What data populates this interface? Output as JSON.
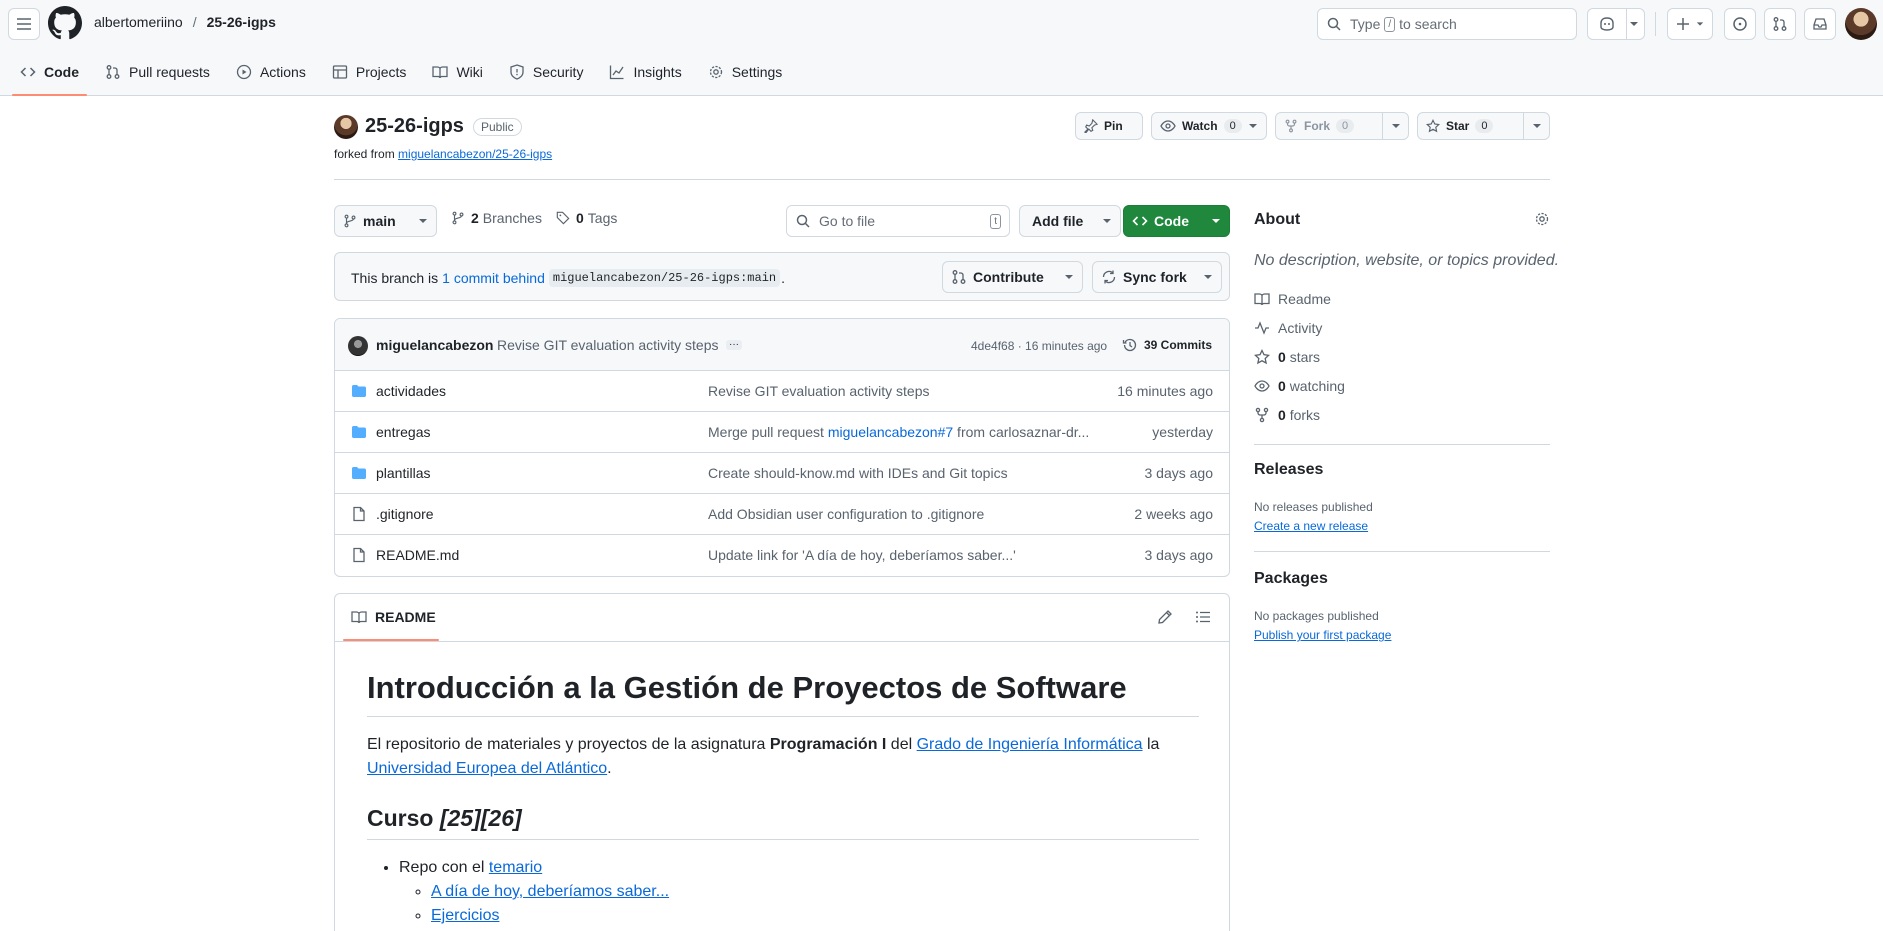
{
  "header": {
    "owner": "albertomeriino",
    "separator": "/",
    "repo": "25-26-igps",
    "search_prefix": "Type",
    "search_key": "/",
    "search_suffix": "to search"
  },
  "tabs": [
    {
      "label": "Code",
      "icon": "code-icon"
    },
    {
      "label": "Pull requests",
      "icon": "pull-request-icon"
    },
    {
      "label": "Actions",
      "icon": "play-icon"
    },
    {
      "label": "Projects",
      "icon": "table-icon"
    },
    {
      "label": "Wiki",
      "icon": "book-icon"
    },
    {
      "label": "Security",
      "icon": "shield-icon"
    },
    {
      "label": "Insights",
      "icon": "graph-icon"
    },
    {
      "label": "Settings",
      "icon": "gear-icon"
    }
  ],
  "repo": {
    "name": "25-26-igps",
    "visibility": "Public",
    "forked_prefix": "forked from",
    "forked_from": "miguelancabezon/25-26-igps",
    "pin": "Pin",
    "watch": "Watch",
    "watch_count": "0",
    "fork": "Fork",
    "fork_count": "0",
    "star": "Star",
    "star_count": "0"
  },
  "branchbar": {
    "branch": "main",
    "branches_count": "2",
    "branches_label": "Branches",
    "tags_count": "0",
    "tags_label": "Tags",
    "goto_placeholder": "Go to file",
    "goto_key": "t",
    "add_file": "Add file",
    "code": "Code"
  },
  "behind": {
    "prefix": "This branch is",
    "link": "1 commit behind",
    "ref": "miguelancabezon/25-26-igps:main",
    "suffix": ".",
    "contribute": "Contribute",
    "sync": "Sync fork"
  },
  "commit": {
    "author": "miguelancabezon",
    "message": "Revise GIT evaluation activity steps",
    "dots": "···",
    "hash_time": "4de4f68 · 16 minutes ago",
    "count": "39 Commits"
  },
  "files": [
    {
      "name": "actividades",
      "type": "folder",
      "msg": "Revise GIT evaluation activity steps",
      "date": "16 minutes ago"
    },
    {
      "name": "entregas",
      "type": "folder",
      "msg_prefix": "Merge pull request ",
      "msg_link": "miguelancabezon#7",
      "msg_suffix": " from carlosaznar-dr...",
      "date": "yesterday"
    },
    {
      "name": "plantillas",
      "type": "folder",
      "msg": "Create should-know.md with IDEs and Git topics",
      "date": "3 days ago"
    },
    {
      "name": ".gitignore",
      "type": "file",
      "msg": "Add Obsidian user configuration to .gitignore",
      "date": "2 weeks ago"
    },
    {
      "name": "README.md",
      "type": "file",
      "msg": "Update link for 'A día de hoy, deberíamos saber...'",
      "date": "3 days ago"
    }
  ],
  "readme": {
    "tab": "README",
    "h1": "Introducción a la Gestión de Proyectos de Software",
    "p_prefix": "El repositorio de materiales y proyectos de la asignatura ",
    "p_bold": "Programación I",
    "p_mid": " del ",
    "p_link1": "Grado de Ingeniería Informática",
    "p_mid2": " la ",
    "p_link2": "Universidad Europea del Atlántico",
    "p_end": ".",
    "h2_prefix": "Curso ",
    "h2_em": "[25][26]",
    "li1_prefix": "Repo con el ",
    "li1_link": "temario",
    "li1a": "A día de hoy, deberíamos saber...",
    "li1b": "Ejercicios"
  },
  "sidebar": {
    "about": "About",
    "description": "No description, website, or topics provided.",
    "readme": "Readme",
    "activity": "Activity",
    "stars_count": "0",
    "stars_label": "stars",
    "watching_count": "0",
    "watching_label": "watching",
    "forks_count": "0",
    "forks_label": "forks",
    "releases": "Releases",
    "no_releases": "No releases published",
    "create_release": "Create a new release",
    "packages": "Packages",
    "no_packages": "No packages published",
    "publish_package": "Publish your first package"
  },
  "colors": {
    "accent_link": "#0969da",
    "primary_button": "#1f883d",
    "tab_underline": "#fd8c73",
    "folder": "#54aeff"
  }
}
